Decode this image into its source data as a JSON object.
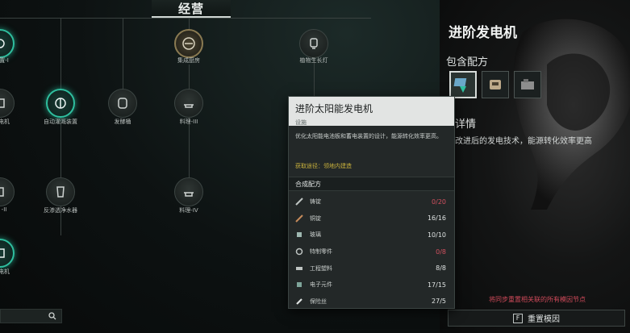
{
  "section_title": "经营",
  "tree_nodes": [
    {
      "label": "集成厨房",
      "icon": "kitchen-icon"
    },
    {
      "label": "植物生长灯",
      "icon": "lamp-icon"
    },
    {
      "label": "自动灌溉装置",
      "icon": "irrigation-icon"
    },
    {
      "label": "发酵桶",
      "icon": "barrel-icon"
    },
    {
      "label": "料理-III",
      "icon": "cooking-icon"
    },
    {
      "label": "反渗透净水器",
      "icon": "purifier-icon"
    },
    {
      "label": "料理-IV",
      "icon": "cooking-icon"
    },
    {
      "label": "置-I",
      "icon": "device-icon"
    },
    {
      "label": "电机",
      "icon": "generator-icon"
    },
    {
      "label": "-II",
      "icon": "device-icon"
    },
    {
      "label": "电机",
      "icon": "generator-icon"
    }
  ],
  "panel": {
    "title": "进阶发电机",
    "recipes_heading": "包含配方",
    "detail_heading": "详情",
    "detail_text": "改进后的发电技术，能源转化效率更高",
    "warning": "将同步重置相关联的所有模因节点",
    "reset_key": "F",
    "reset_label": "重置模因"
  },
  "tooltip": {
    "name": "进阶太阳能发电机",
    "type": "设施",
    "description": "优化太阳能电池板和蓄电装置的设计，能源转化效率更高。",
    "source_label": "获取途径：",
    "source_value": "领地内建造",
    "materials_heading": "合成配方",
    "materials": [
      {
        "name": "铸锭",
        "count": "0/20",
        "short": true,
        "icon": "ingot-icon"
      },
      {
        "name": "铜锭",
        "count": "16/16",
        "short": false,
        "icon": "copper-icon"
      },
      {
        "name": "玻璃",
        "count": "10/10",
        "short": false,
        "icon": "glass-icon"
      },
      {
        "name": "特制零件",
        "count": "0/8",
        "short": true,
        "icon": "part-icon"
      },
      {
        "name": "工程塑料",
        "count": "8/8",
        "short": false,
        "icon": "plastic-icon"
      },
      {
        "name": "电子元件",
        "count": "17/15",
        "short": false,
        "icon": "chip-icon"
      },
      {
        "name": "保险丝",
        "count": "27/5",
        "short": false,
        "icon": "fuse-icon"
      }
    ]
  },
  "colors": {
    "accent_teal": "#2fbf9f",
    "shortage_red": "#d2505f",
    "source_gold": "#c9b13c"
  }
}
